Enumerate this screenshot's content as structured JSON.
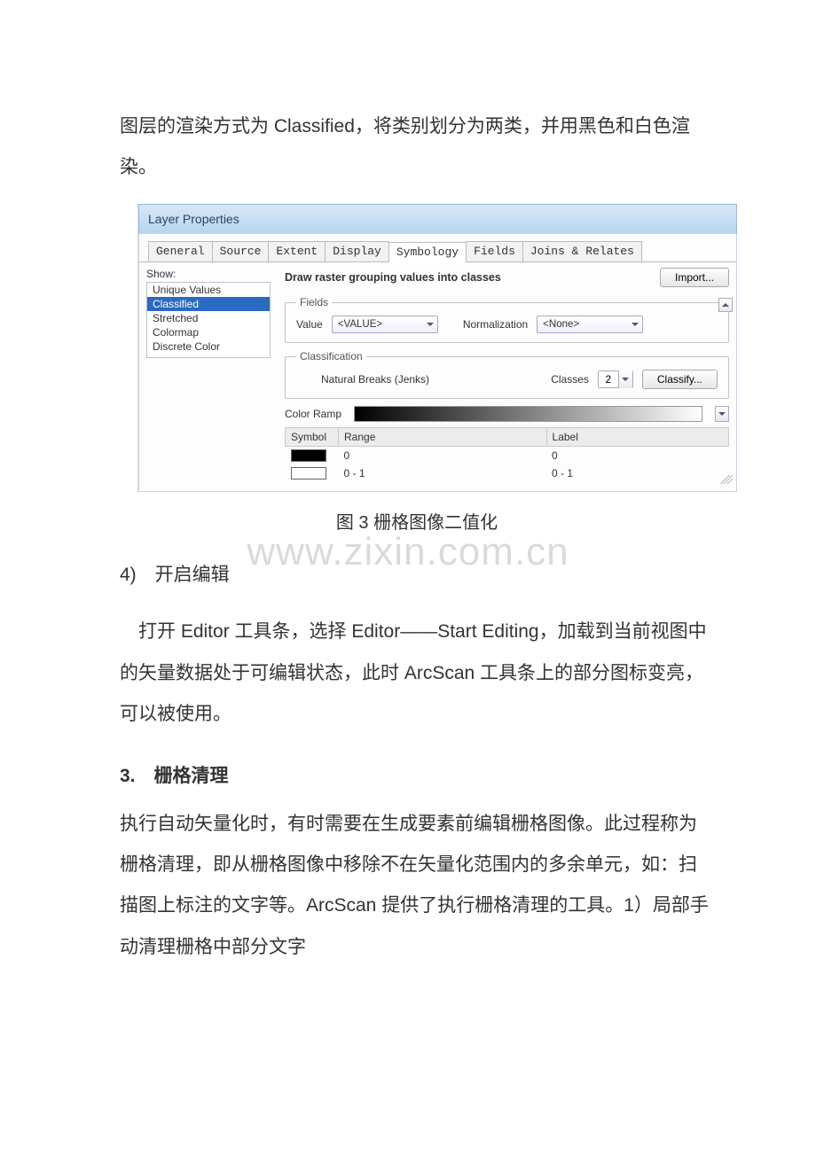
{
  "body": {
    "intro": "图层的渲染方式为 Classified，将类别划分为两类，并用黑色和白色渲染。",
    "figcap": "图 3 栅格图像二值化",
    "step4_label": "4) 开启编辑",
    "step4_body": "打开 Editor 工具条，选择 Editor——Start Editing，加载到当前视图中的矢量数据处于可编辑状态，此时 ArcScan 工具条上的部分图标变亮，可以被使用。",
    "sec3_title": "3. 栅格清理",
    "sec3_body": "执行自动矢量化时，有时需要在生成要素前编辑栅格图像。此过程称为栅格清理，即从栅格图像中移除不在矢量化范围内的多余单元，如：扫描图上标注的文字等。ArcScan 提供了执行栅格清理的工具。1）局部手动清理栅格中部分文字"
  },
  "watermark": "www.zixin.com.cn",
  "dialog": {
    "title": "Layer Properties",
    "tabs": [
      "General",
      "Source",
      "Extent",
      "Display",
      "Symbology",
      "Fields",
      "Joins & Relates"
    ],
    "active_tab": 4,
    "show_label": "Show:",
    "show_items": [
      "Unique Values",
      "Classified",
      "Stretched",
      "Colormap",
      "Discrete Color"
    ],
    "show_selected": 1,
    "title2": "Draw raster grouping values into classes",
    "import_btn": "Import...",
    "fields_legend": "Fields",
    "value_label": "Value",
    "value_dd": "<VALUE>",
    "norm_label": "Normalization",
    "norm_dd": "<None>",
    "class_legend": "Classification",
    "class_method": "Natural Breaks (Jenks)",
    "classes_label": "Classes",
    "classes_value": "2",
    "classify_btn": "Classify...",
    "colorramp_label": "Color Ramp",
    "tbl_headers": [
      "Symbol",
      "Range",
      "Label"
    ],
    "rows": [
      {
        "swatch": "black",
        "range": "0",
        "label": "0"
      },
      {
        "swatch": "white",
        "range": "0 - 1",
        "label": "0 - 1"
      }
    ]
  }
}
